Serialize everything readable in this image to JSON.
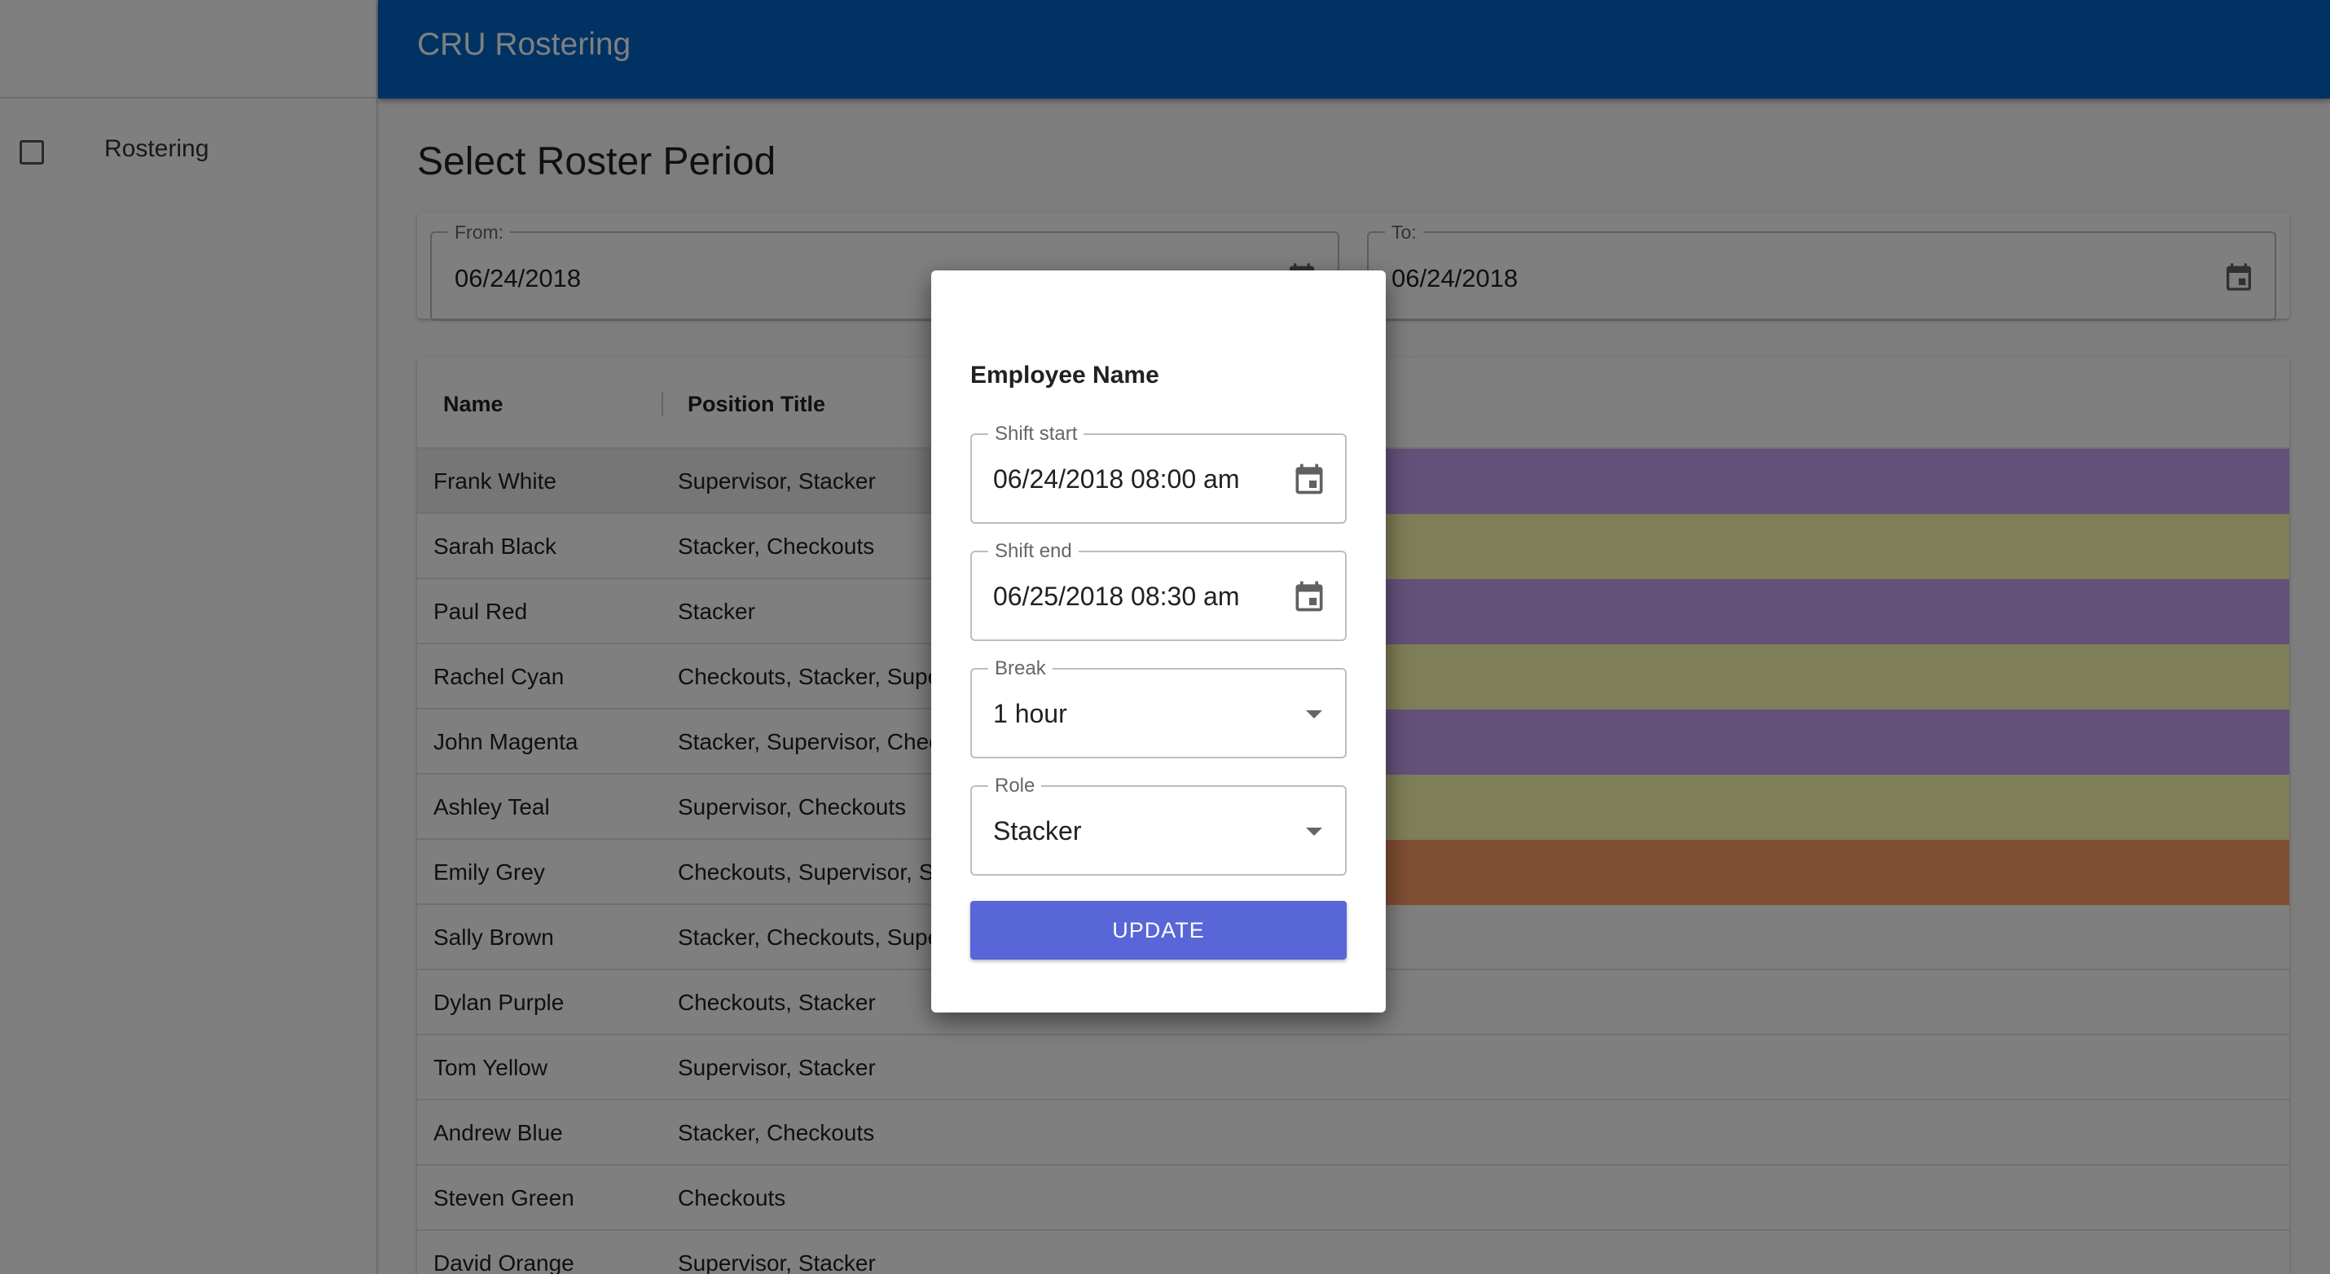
{
  "app": {
    "title": "CRU Rostering"
  },
  "sidebar": {
    "items": [
      {
        "label": "Rostering",
        "icon": "checkbox-outline-icon"
      }
    ]
  },
  "main": {
    "title": "Select Roster Period",
    "period": {
      "from": {
        "label": "From:",
        "value": "06/24/2018",
        "icon": "calendar-icon"
      },
      "to": {
        "label": "To:",
        "value": "06/24/2018",
        "icon": "calendar-icon"
      }
    },
    "table": {
      "columns": [
        "Name",
        "Position Title"
      ],
      "rows": [
        {
          "name": "Frank White",
          "position": "Supervisor, Stacker",
          "shift_color": "#c9a2f5"
        },
        {
          "name": "Sarah Black",
          "position": "Stacker, Checkouts",
          "shift_color": "#fdfdb0"
        },
        {
          "name": "Paul Red",
          "position": "Stacker",
          "shift_color": "#c9a2f5"
        },
        {
          "name": "Rachel Cyan",
          "position": "Checkouts, Stacker, Supe",
          "shift_color": "#fdfdb0"
        },
        {
          "name": "John Magenta",
          "position": "Stacker, Supervisor, Chec",
          "shift_color": "#c9a2f5"
        },
        {
          "name": "Ashley Teal",
          "position": "Supervisor, Checkouts",
          "shift_color": "#fdfdb0"
        },
        {
          "name": "Emily Grey",
          "position": "Checkouts, Supervisor, S",
          "shift_color": "#ff9c66"
        },
        {
          "name": "Sally Brown",
          "position": "Stacker, Checkouts, Supe",
          "shift_color": ""
        },
        {
          "name": "Dylan Purple",
          "position": "Checkouts, Stacker",
          "shift_color": ""
        },
        {
          "name": "Tom Yellow",
          "position": "Supervisor, Stacker",
          "shift_color": ""
        },
        {
          "name": "Andrew Blue",
          "position": "Stacker, Checkouts",
          "shift_color": ""
        },
        {
          "name": "Steven Green",
          "position": "Checkouts",
          "shift_color": ""
        },
        {
          "name": "David Orange",
          "position": "Supervisor, Stacker",
          "shift_color": ""
        }
      ]
    }
  },
  "dialog": {
    "title": "Employee Name",
    "shift_start": {
      "label": "Shift start",
      "value": "06/24/2018 08:00 am",
      "icon": "calendar-icon"
    },
    "shift_end": {
      "label": "Shift end",
      "value": "06/25/2018 08:30 am",
      "icon": "calendar-icon"
    },
    "break": {
      "label": "Break",
      "value": "1 hour",
      "icon": "dropdown-arrow-icon"
    },
    "role": {
      "label": "Role",
      "value": "Stacker",
      "icon": "dropdown-arrow-icon"
    },
    "update_label": "UPDATE"
  },
  "colors": {
    "appbar": "#0064c9",
    "button": "#5866d8",
    "shift_purple": "#c9a2f5",
    "shift_yellow": "#fdfdb0",
    "shift_orange": "#ff9c66"
  }
}
